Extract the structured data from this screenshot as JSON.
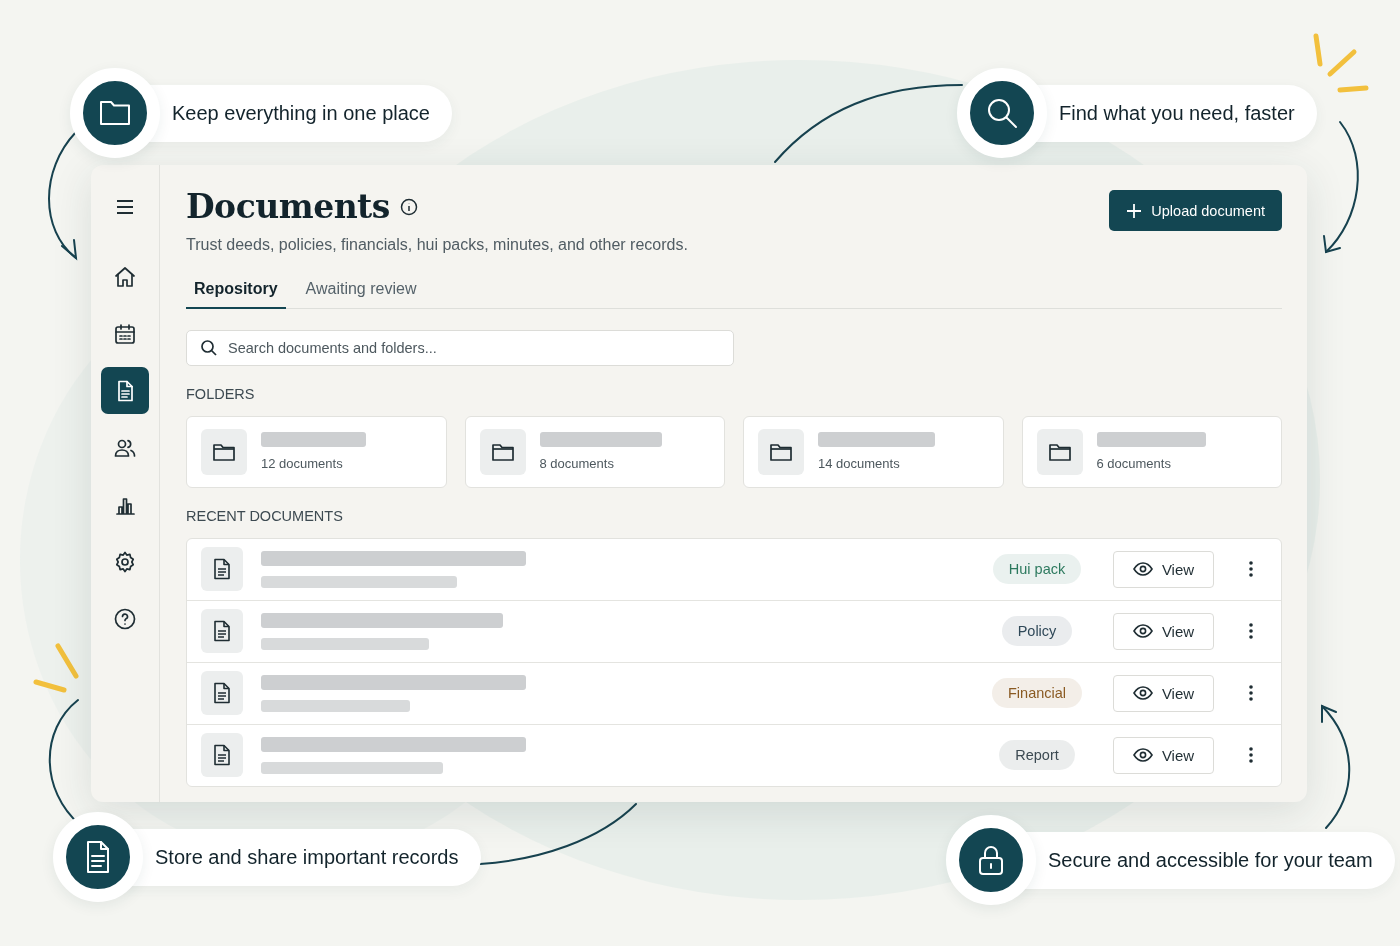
{
  "callouts": [
    {
      "text": "Keep everything in one place"
    },
    {
      "text": "Find what you need, faster"
    },
    {
      "text": "Store and share important records"
    },
    {
      "text": "Secure and accessible for your team"
    }
  ],
  "sidebar": {
    "items": [
      {
        "selected": false
      },
      {
        "selected": false
      },
      {
        "selected": true
      },
      {
        "selected": false
      },
      {
        "selected": false
      },
      {
        "selected": false
      },
      {
        "selected": false
      }
    ]
  },
  "header": {
    "title": "Documents",
    "subtitle": "Trust deeds, policies, financials, hui packs, minutes, and other records.",
    "upload_button": "Upload document"
  },
  "tabs": [
    {
      "label": "Repository",
      "selected": true
    },
    {
      "label": "Awaiting review",
      "selected": false
    }
  ],
  "search": {
    "placeholder": "Search documents and folders..."
  },
  "folders": {
    "heading": "FOLDERS",
    "items": [
      {
        "count": "12 documents"
      },
      {
        "count": "8 documents"
      },
      {
        "count": "14 documents"
      },
      {
        "count": "6 documents"
      }
    ]
  },
  "recent": {
    "heading": "RECENT DOCUMENTS",
    "rows": [
      {
        "tag": "Hui pack",
        "color": "#2d7a5f",
        "action": "View"
      },
      {
        "tag": "Policy",
        "color": "#2f4858",
        "action": "View"
      },
      {
        "tag": "Financial",
        "color": "#8a5a22",
        "action": "View"
      },
      {
        "tag": "Report",
        "color": "#3c4a52",
        "action": "View"
      }
    ]
  }
}
